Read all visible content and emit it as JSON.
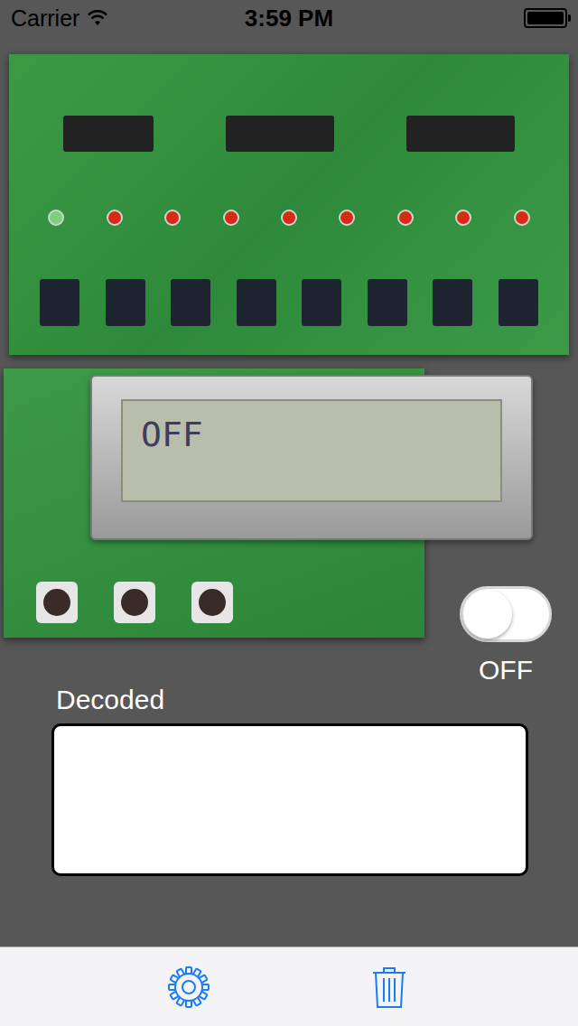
{
  "status_bar": {
    "carrier": "Carrier",
    "time": "3:59 PM",
    "battery": {
      "level": 1
    }
  },
  "lcd": {
    "text": "OFF"
  },
  "power_switch": {
    "on": false,
    "label": "OFF"
  },
  "decoded": {
    "label": "Decoded",
    "value": ""
  }
}
